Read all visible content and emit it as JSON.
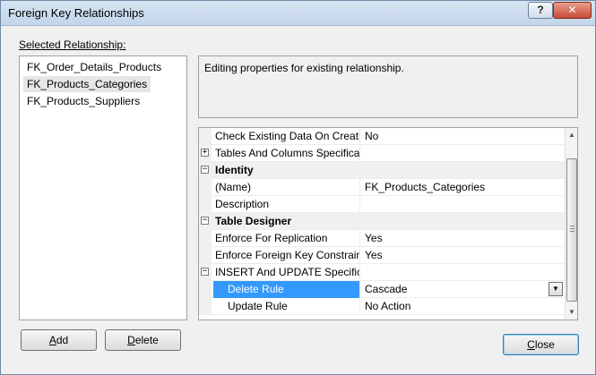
{
  "window": {
    "title": "Foreign Key Relationships",
    "help_label": "?",
    "close_label": "✕"
  },
  "relationships": {
    "label": "Selected Relationship:",
    "items": [
      {
        "label": "FK_Order_Details_Products",
        "selected": false
      },
      {
        "label": "FK_Products_Categories",
        "selected": true
      },
      {
        "label": "FK_Products_Suppliers",
        "selected": false
      }
    ]
  },
  "description": {
    "text": "Editing properties for existing relationship."
  },
  "properties": {
    "rows": [
      {
        "name": "Check Existing Data On Creatio",
        "value": "No",
        "type": "prop"
      },
      {
        "name": "Tables And Columns Specificat",
        "value": "",
        "type": "prop",
        "expander": "+"
      },
      {
        "name": "Identity",
        "value": "",
        "type": "category",
        "expander": "−"
      },
      {
        "name": "(Name)",
        "value": "FK_Products_Categories",
        "type": "prop"
      },
      {
        "name": "Description",
        "value": "",
        "type": "prop"
      },
      {
        "name": "Table Designer",
        "value": "",
        "type": "category",
        "expander": "−"
      },
      {
        "name": "Enforce For Replication",
        "value": "Yes",
        "type": "prop"
      },
      {
        "name": "Enforce Foreign Key Constraint",
        "value": "Yes",
        "type": "prop"
      },
      {
        "name": "INSERT And UPDATE Specificat",
        "value": "",
        "type": "prop",
        "expander": "−"
      },
      {
        "name": "Delete Rule",
        "value": "Cascade",
        "type": "subprop",
        "selected": true
      },
      {
        "name": "Update Rule",
        "value": "No Action",
        "type": "subprop"
      }
    ]
  },
  "buttons": {
    "add": "Add",
    "delete": "Delete",
    "close": "Close"
  },
  "icons": {
    "expand": "plus-box-icon",
    "collapse": "minus-box-icon",
    "dropdown": "chevron-down-icon",
    "scroll_up": "scroll-up-arrow-icon",
    "scroll_down": "scroll-down-arrow-icon"
  }
}
